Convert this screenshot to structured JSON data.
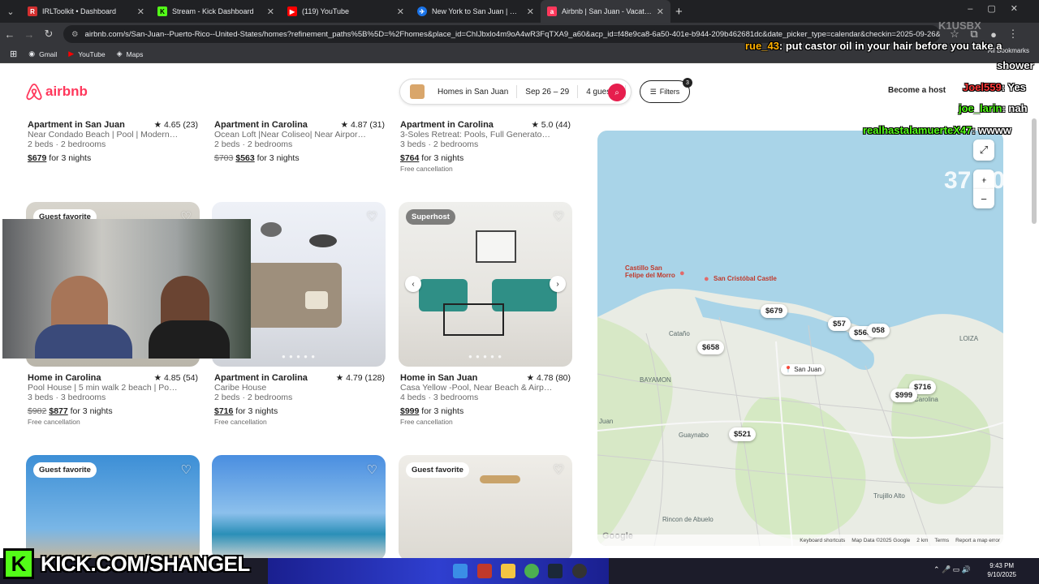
{
  "browser": {
    "tabs": [
      {
        "title": "IRLToolkit • Dashboard",
        "icon": "irltoolkit-icon",
        "color": "#d32f2f"
      },
      {
        "title": "Stream - Kick Dashboard",
        "icon": "kick-icon",
        "color": "#53fc18"
      },
      {
        "title": "(119) YouTube",
        "icon": "youtube-icon",
        "color": "#ff0000"
      },
      {
        "title": "New York to San Juan | Google",
        "icon": "google-flights-icon",
        "color": "#1a73e8"
      },
      {
        "title": "Airbnb | San Juan - Vacation Re",
        "icon": "airbnb-icon",
        "color": "#ff385c"
      }
    ],
    "url": "airbnb.com/s/San-Juan--Puerto-Rico--United-States/homes?refinement_paths%5B%5D=%2Fhomes&place_id=ChIJbxlo4m9oA4wR3FqTXA9_a60&acp_id=f48e9ca8-6a50-401e-b944-209b462681dc&date_picker_type=calendar&checkin=2025-09-26&chec...",
    "bookmarks": [
      "Gmail",
      "YouTube",
      "Maps"
    ],
    "all_bookmarks": "All Bookmarks"
  },
  "airbnb": {
    "logo_text": "airbnb",
    "search": {
      "location": "Homes in San Juan",
      "dates": "Sep 26 – 29",
      "guests": "4 guests"
    },
    "filters_label": "Filters",
    "filters_count": "3",
    "become_host": "Become a host"
  },
  "listings": [
    {
      "title": "Apartment in San Juan",
      "rating": "★ 4.65 (23)",
      "desc": "Near Condado Beach | Pool | Modern 2-...",
      "beds": "2 beds · 2 bedrooms",
      "old_price": "",
      "price": "$679",
      "nights": "for 3 nights",
      "free": ""
    },
    {
      "title": "Apartment in Carolina",
      "rating": "★ 4.87 (31)",
      "desc": "Ocean Loft |Near Coliseo| Near Airport |Nea...",
      "beds": "2 beds · 2 bedrooms",
      "old_price": "$703",
      "price": "$563",
      "nights": "for 3 nights",
      "free": ""
    },
    {
      "title": "Apartment in Carolina",
      "rating": "★ 5.0 (44)",
      "desc": "3-Soles Retreat: Pools, Full Generator &...",
      "beds": "3 beds · 2 bedrooms",
      "old_price": "",
      "price": "$764",
      "nights": "for 3 nights",
      "free": "Free cancellation"
    },
    {
      "title": "Home in Carolina",
      "rating": "★ 4.85 (54)",
      "desc": "Pool House | 5 min walk 2 beach | Power...",
      "beds": "3 beds · 3 bedrooms",
      "old_price": "$982",
      "price": "$877",
      "nights": "for 3 nights",
      "free": "Free cancellation",
      "badge": "Guest favorite"
    },
    {
      "title": "Apartment in Carolina",
      "rating": "★ 4.79 (128)",
      "desc": "Caribe House",
      "beds": "2 beds · 2 bedrooms",
      "old_price": "",
      "price": "$716",
      "nights": "for 3 nights",
      "free": "Free cancellation"
    },
    {
      "title": "Home in San Juan",
      "rating": "★ 4.78 (80)",
      "desc": "Casa Yellow -Pool, Near Beach & Airport",
      "beds": "4 beds · 3 bedrooms",
      "old_price": "",
      "price": "$999",
      "nights": "for 3 nights",
      "free": "Free cancellation",
      "badge": "Superhost"
    },
    {
      "badge": "Guest favorite"
    },
    {
      "badge": ""
    },
    {
      "badge": "Guest favorite"
    }
  ],
  "map": {
    "pins": [
      "$679",
      "$658",
      "$57",
      "$563",
      "058",
      "$716",
      "$999",
      "$521"
    ],
    "labels": {
      "castillo": "Castillo San\nFelipe del Morro",
      "cristobal": "San Cristóbal Castle",
      "san_juan": "San Juan",
      "catano": "Cataño",
      "bayamon": "BAYAMON",
      "guaynabo": "Guaynabo",
      "carolina": "Carolina",
      "loiza": "LOIZA",
      "trujillo": "Trujillo Alto",
      "juan": "Juan",
      "rincon": "Rincon de Abuelo"
    },
    "footer": [
      "Keyboard shortcuts",
      "Map Data ©2025 Google",
      "2 km",
      "Terms",
      "Report a map error"
    ],
    "google": "Google"
  },
  "overlay": {
    "counter_partial": "37 40",
    "streamer_tag": "K1USBX",
    "chat": [
      {
        "user": "rue_43",
        "msg": ": put castor oil in your hair before you take a",
        "color": "#ffb000"
      },
      {
        "user": "",
        "msg": "shower",
        "color": "#ffffff"
      },
      {
        "user": "Joel559",
        "msg": ": Yes",
        "color": "#ff3b3b"
      },
      {
        "user": "joe_larin",
        "msg": ": nah",
        "color": "#53fc18"
      },
      {
        "user": "realhastalamuerteX47",
        "msg": ": wwww",
        "color": "#53fc18"
      }
    ],
    "kick_url": "KICK.COM/SHANGEL",
    "kick_letter": "K"
  },
  "system": {
    "time": "9:43 PM",
    "date": "9/10/2025"
  }
}
